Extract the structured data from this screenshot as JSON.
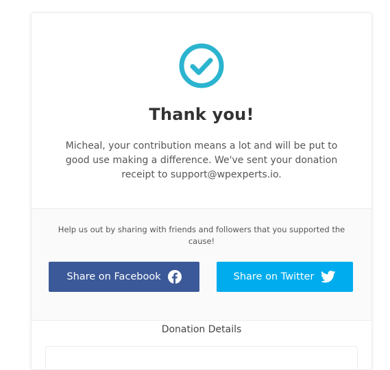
{
  "confirmation": {
    "icon": "check-circle-icon",
    "icon_color": "#2bb4cf",
    "title": "Thank you!",
    "message": "Micheal, your contribution means a lot and will be put to good use making a difference. We've sent your donation receipt to support@wpexperts.io."
  },
  "share": {
    "prompt": "Help us out by sharing with friends and followers that you supported the cause!",
    "facebook_label": "Share on Facebook",
    "facebook_color": "#3b5998",
    "facebook_icon": "facebook-icon",
    "twitter_label": "Share on Twitter",
    "twitter_color": "#00aced",
    "twitter_icon": "twitter-icon"
  },
  "details": {
    "title": "Donation Details"
  }
}
